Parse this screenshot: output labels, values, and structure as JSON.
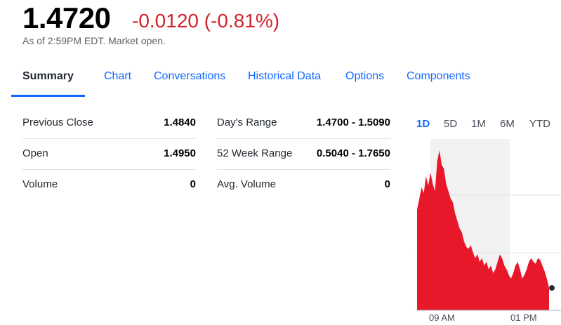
{
  "quote": {
    "price": "1.4720",
    "change": "-0.0120 (-0.81%)",
    "as_of": "As of 2:59PM EDT. Market open."
  },
  "tabs": [
    {
      "label": "Summary",
      "active": true
    },
    {
      "label": "Chart"
    },
    {
      "label": "Conversations"
    },
    {
      "label": "Historical Data"
    },
    {
      "label": "Options"
    },
    {
      "label": "Components"
    }
  ],
  "stats_left": [
    {
      "label": "Previous Close",
      "value": "1.4840"
    },
    {
      "label": "Open",
      "value": "1.4950"
    },
    {
      "label": "Volume",
      "value": "0"
    }
  ],
  "stats_right": [
    {
      "label": "Day's Range",
      "value": "1.4700 - 1.5090"
    },
    {
      "label": "52 Week Range",
      "value": "0.5040 - 1.7650"
    },
    {
      "label": "Avg. Volume",
      "value": "0"
    }
  ],
  "ranges": [
    {
      "label": "1D",
      "active": true
    },
    {
      "label": "5D"
    },
    {
      "label": "1M"
    },
    {
      "label": "6M"
    },
    {
      "label": "YTD"
    }
  ],
  "colors": {
    "accent": "#0f69ff",
    "negative": "#d3212c",
    "chart_fill": "#e8172a"
  },
  "chart_data": {
    "type": "area",
    "x_tick_labels": [
      "09 AM",
      "01 PM"
    ],
    "previous_close": 1.484,
    "ylim": [
      1.466,
      1.512
    ],
    "series": [
      {
        "values": [
          1.493,
          1.496,
          1.499,
          1.4975,
          1.502,
          1.4995,
          1.503,
          1.5,
          1.498,
          1.506,
          1.509,
          1.505,
          1.504,
          1.5,
          1.498,
          1.496,
          1.495,
          1.492,
          1.49,
          1.488,
          1.487,
          1.4845,
          1.483,
          1.4825,
          1.4835,
          1.4815,
          1.48,
          1.481,
          1.479,
          1.48,
          1.478,
          1.479,
          1.477,
          1.478,
          1.476,
          1.477,
          1.479,
          1.481,
          1.48,
          1.478,
          1.477,
          1.4755,
          1.4745,
          1.476,
          1.478,
          1.479,
          1.477,
          1.4745,
          1.4755,
          1.477,
          1.479,
          1.48,
          1.479,
          1.4785,
          1.48,
          1.4795,
          1.478,
          1.4765,
          1.4745,
          1.472
        ]
      }
    ]
  }
}
